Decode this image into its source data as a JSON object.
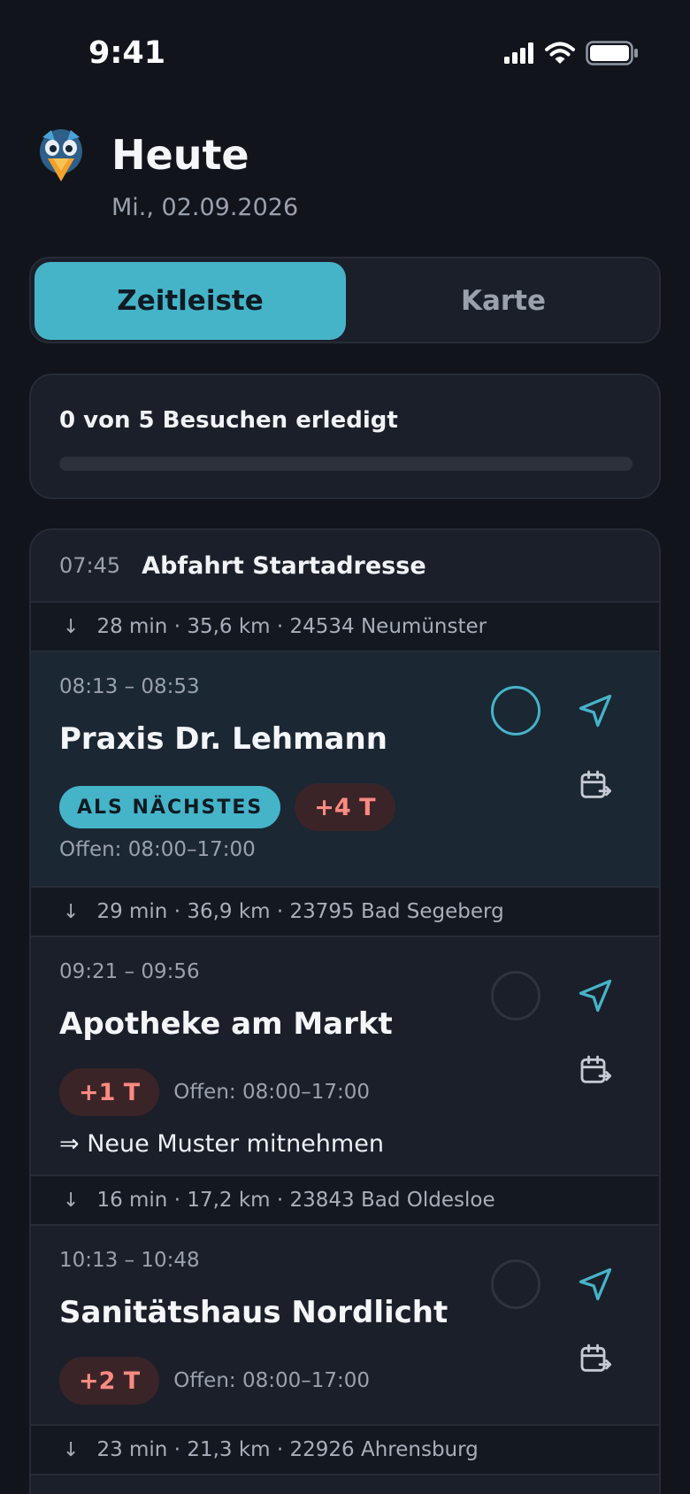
{
  "status_bar": {
    "time": "9:41"
  },
  "header": {
    "title": "Heute",
    "date": "Mi., 02.09.2026"
  },
  "tabs": [
    {
      "label": "Zeitleiste",
      "active": true
    },
    {
      "label": "Karte",
      "active": false
    }
  ],
  "progress": {
    "text": "0 von 5 Besuchen erledigt",
    "done": 0,
    "total": 5
  },
  "timeline": {
    "start": {
      "time": "07:45",
      "label": "Abfahrt Startadresse"
    },
    "travels": [
      "28 min · 35,6 km · 24534 Neumünster",
      "29 min · 36,9 km · 23795 Bad Segeberg",
      "16 min · 17,2 km · 23843 Bad Oldesloe",
      "23 min · 21,3 km · 22926 Ahrensburg"
    ],
    "stops": [
      {
        "time": "08:13 – 08:53",
        "name": "Praxis Dr. Lehmann",
        "next_badge": "ALS NÄCHSTES",
        "days": "+4 T",
        "hours": "Offen: 08:00–17:00"
      },
      {
        "time": "09:21 – 09:56",
        "name": "Apotheke am Markt",
        "days": "+1 T",
        "hours": "Offen: 08:00–17:00",
        "note": "⇒ Neue Muster mitnehmen"
      },
      {
        "time": "10:13 – 10:48",
        "name": "Sanitätshaus Nordlicht",
        "days": "+2 T",
        "hours": "Offen: 08:00–17:00"
      }
    ]
  },
  "icons": {
    "travel": "down-arrow-icon",
    "navigate": "navigation-arrow-icon",
    "reschedule": "calendar-move-icon",
    "done": "checkbox-circle-icon"
  },
  "colors": {
    "accent": "#45b4c9",
    "warning": "#ff8a80",
    "background": "#11141b",
    "card": "#1b1f29"
  }
}
